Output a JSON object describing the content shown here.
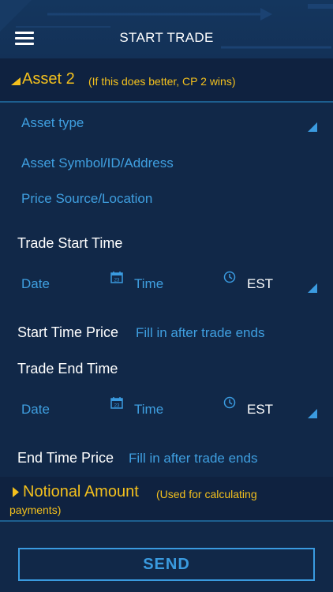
{
  "header": {
    "title": "START TRADE",
    "menu_icon": "hamburger-menu-icon"
  },
  "asset": {
    "title": "Asset 2",
    "note": "(If this does better, CP 2 wins)",
    "asset_type_placeholder": "Asset type",
    "symbol_placeholder": "Asset Symbol/ID/Address",
    "price_source_placeholder": "Price Source/Location"
  },
  "trade_start": {
    "label": "Trade Start Time",
    "date_placeholder": "Date",
    "time_placeholder": "Time",
    "timezone": "EST"
  },
  "start_price": {
    "label": "Start Time Price",
    "value": "Fill in after trade ends"
  },
  "trade_end": {
    "label": "Trade End Time",
    "date_placeholder": "Date",
    "time_placeholder": "Time",
    "timezone": "EST"
  },
  "end_price": {
    "label": "End Time Price",
    "value": "Fill in after trade ends"
  },
  "notional": {
    "title": "Notional Amount",
    "note_line1": "(Used for calculating",
    "note_line2": "payments)"
  },
  "send": {
    "label": "SEND"
  },
  "colors": {
    "accent": "#3a9be0",
    "highlight": "#f3c01d",
    "background": "#112848"
  }
}
